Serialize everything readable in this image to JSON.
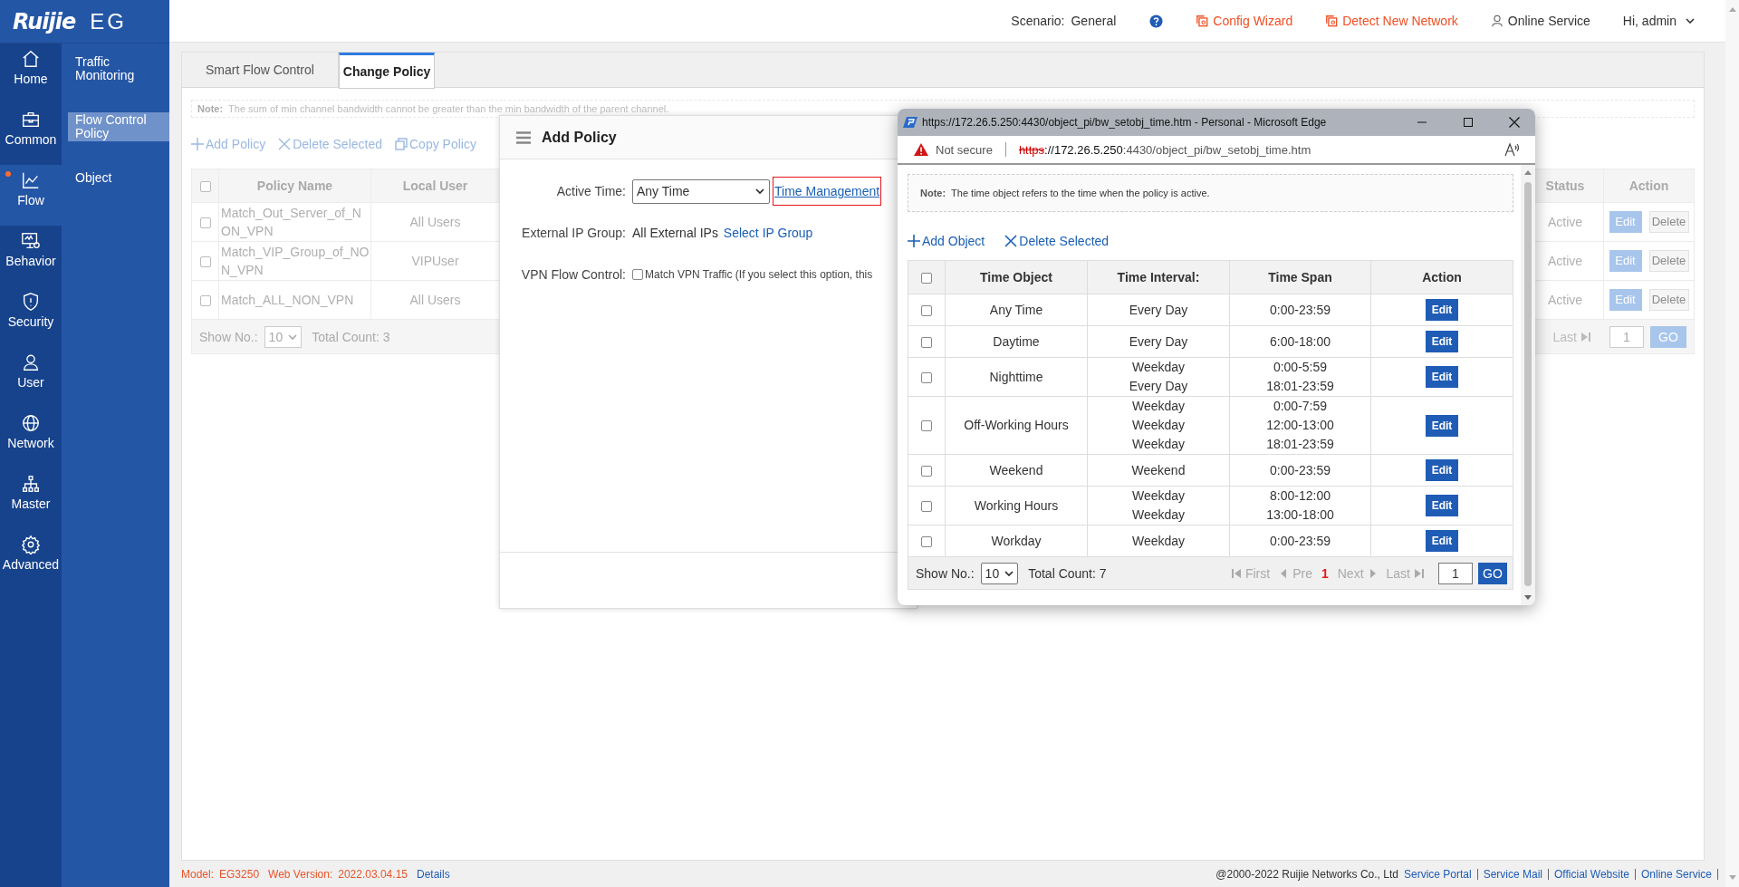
{
  "brand": {
    "logo": "Ruijie",
    "product": "EG"
  },
  "nav": [
    {
      "label": "Home",
      "kind": "home",
      "selected": false,
      "dot": false
    },
    {
      "label": "Common",
      "kind": "common",
      "selected": false,
      "dot": false
    },
    {
      "label": "Flow",
      "kind": "flow",
      "selected": true,
      "dot": true
    },
    {
      "label": "Behavior",
      "kind": "behavior",
      "selected": false,
      "dot": false
    },
    {
      "label": "Security",
      "kind": "security",
      "selected": false,
      "dot": false
    },
    {
      "label": "User",
      "kind": "user",
      "selected": false,
      "dot": false
    },
    {
      "label": "Network",
      "kind": "network",
      "selected": false,
      "dot": false
    },
    {
      "label": "Master",
      "kind": "master",
      "selected": false,
      "dot": false
    },
    {
      "label": "Advanced",
      "kind": "advanced",
      "selected": false,
      "dot": false
    }
  ],
  "subnav": [
    {
      "label": "Traffic Monitoring",
      "selected": false
    },
    {
      "label": "Flow Control Policy",
      "selected": true
    },
    {
      "label": "Object",
      "selected": false
    }
  ],
  "top_bar": {
    "scenario_label": "Scenario:",
    "scenario_value": "General",
    "links": [
      {
        "label": "Config Wizard",
        "kind": "wizard"
      },
      {
        "label": "Detect New Network",
        "kind": "wizard"
      },
      {
        "label": "Online Service",
        "kind": "service"
      }
    ],
    "user": "Hi, admin"
  },
  "tabs": [
    {
      "label": "Smart Flow Control",
      "selected": false
    },
    {
      "label": "Change Policy",
      "selected": true
    }
  ],
  "note": {
    "label": "Note:",
    "text": "The sum of min channel bandwidth cannot be greater than the min bandwidth of the parent channel."
  },
  "toolbar": [
    {
      "label": "Add Policy",
      "kind": "add"
    },
    {
      "label": "Delete Selected",
      "kind": "delete"
    },
    {
      "label": "Copy Policy",
      "kind": "copy"
    }
  ],
  "policy_table": {
    "all_checked": false,
    "columns": [
      "Policy Name",
      "Local User",
      "Status",
      "Action"
    ],
    "rows": [
      {
        "checked": false,
        "name": "Match_Out_Server_of_NON_VPN",
        "user": "All Users",
        "status": "Active",
        "actions": [
          "Edit",
          "Delete"
        ]
      },
      {
        "checked": false,
        "name": "Match_VIP_Group_of_NON_VPN",
        "user": "VIPUser",
        "status": "Active",
        "actions": [
          "Edit",
          "Delete"
        ]
      },
      {
        "checked": false,
        "name": "Match_ALL_NON_VPN",
        "user": "All Users",
        "status": "Active",
        "actions": [
          "Edit",
          "Delete"
        ]
      }
    ]
  },
  "pagination": {
    "show_label": "Show No.:",
    "page_size": "10",
    "total": "Total Count: 3",
    "pager": [
      {
        "label": "Last",
        "kind": "last",
        "disabled": true
      }
    ],
    "page_input": "1",
    "go": "GO"
  },
  "add_policy": {
    "title": "Add Policy",
    "fields": [
      {
        "kind": "select",
        "label": "Active Time:",
        "value": "Any Time",
        "link": "Time Management",
        "highlighted": true
      },
      {
        "kind": "text",
        "label": "External IP Group:",
        "value": "All External IPs",
        "link": "Select IP Group",
        "highlighted": false
      },
      {
        "kind": "checkbox",
        "label": "VPN Flow Control:",
        "checked": false,
        "text": "Match VPN Traffic (If you select this option, this"
      }
    ]
  },
  "popup": {
    "title": "https://172.26.5.250:4430/object_pi/bw_setobj_time.htm - Personal - Microsoft Edge",
    "security": "Not secure",
    "url_scheme": "https",
    "url_host": "://172.26.5.250",
    "url_path": ":4430/object_pi/bw_setobj_time.htm",
    "note": {
      "label": "Note:",
      "text": "The time object refers to the time when the policy is active."
    },
    "toolbar": [
      {
        "label": "Add Object",
        "kind": "add"
      },
      {
        "label": "Delete Selected",
        "kind": "delete"
      }
    ],
    "table": {
      "all_checked": false,
      "columns": [
        "Time Object",
        "Time Interval:",
        "Time Span",
        "Action"
      ],
      "rows": [
        {
          "checked": false,
          "name": "Any Time",
          "intervals": [
            "Every Day"
          ],
          "spans": [
            "0:00-23:59"
          ],
          "action": "Edit"
        },
        {
          "checked": false,
          "name": "Daytime",
          "intervals": [
            "Every Day"
          ],
          "spans": [
            "6:00-18:00"
          ],
          "action": "Edit"
        },
        {
          "checked": false,
          "name": "Nighttime",
          "intervals": [
            "Weekday",
            "Every Day"
          ],
          "spans": [
            "0:00-5:59",
            "18:01-23:59"
          ],
          "action": "Edit"
        },
        {
          "checked": false,
          "name": "Off-Working Hours",
          "intervals": [
            "Weekday",
            "Weekday",
            "Weekday"
          ],
          "spans": [
            "0:00-7:59",
            "12:00-13:00",
            "18:01-23:59"
          ],
          "action": "Edit"
        },
        {
          "checked": false,
          "name": "Weekend",
          "intervals": [
            "Weekend"
          ],
          "spans": [
            "0:00-23:59"
          ],
          "action": "Edit"
        },
        {
          "checked": false,
          "name": "Working Hours",
          "intervals": [
            "Weekday",
            "Weekday"
          ],
          "spans": [
            "8:00-12:00",
            "13:00-18:00"
          ],
          "action": "Edit"
        },
        {
          "checked": false,
          "name": "Workday",
          "intervals": [
            "Weekday"
          ],
          "spans": [
            "0:00-23:59"
          ],
          "action": "Edit"
        }
      ]
    },
    "pagination": {
      "show_label": "Show No.:",
      "page_size": "10",
      "total": "Total Count: 7",
      "pager": [
        {
          "label": "First",
          "kind": "first",
          "disabled": true
        },
        {
          "label": "Pre",
          "kind": "prev",
          "disabled": true
        },
        {
          "label": "1",
          "kind": "page",
          "selected": true
        },
        {
          "label": "Next",
          "kind": "next",
          "disabled": true
        },
        {
          "label": "Last",
          "kind": "last",
          "disabled": true
        }
      ],
      "page_input": "1",
      "go": "GO"
    }
  },
  "footer": {
    "model_label": "Model:",
    "model": "EG3250",
    "version_label": "Web Version:",
    "version": "2022.03.04.15",
    "details": "Details",
    "copyright": "@2000-2022 Ruijie Networks Co., Ltd",
    "links": [
      "Service Portal",
      "Service Mail",
      "Official Website",
      "Online Service"
    ]
  }
}
